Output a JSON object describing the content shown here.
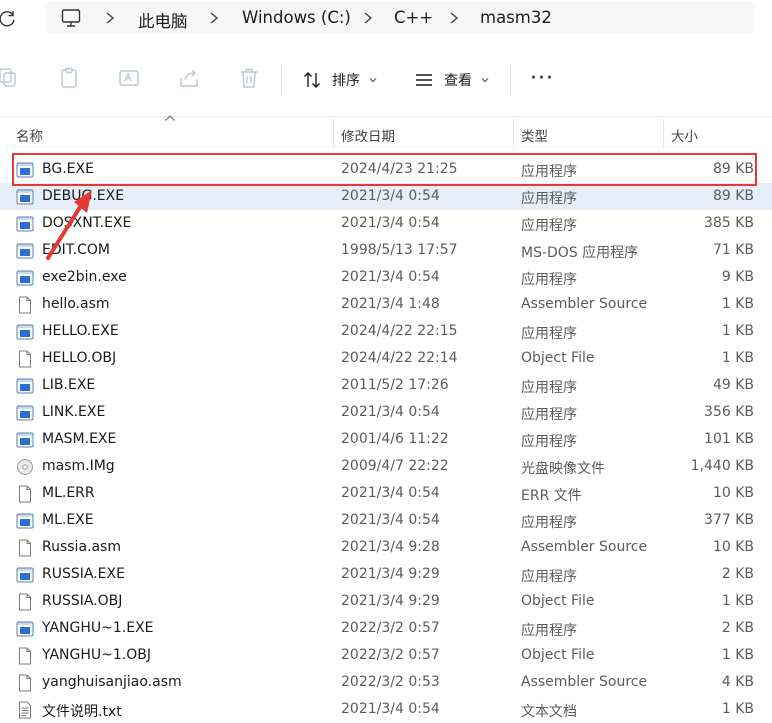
{
  "address": {
    "crumbs": [
      "此电脑",
      "Windows (C:)",
      "C++",
      "masm32"
    ]
  },
  "toolbar": {
    "sort_label": "排序",
    "view_label": "查看",
    "more_label": "···"
  },
  "columns": {
    "name": "名称",
    "date": "修改日期",
    "type": "类型",
    "size": "大小"
  },
  "files": [
    {
      "name": "BG.EXE",
      "date": "2024/4/23 21:25",
      "type": "应用程序",
      "size": "89 KB",
      "icon": "exe-icon"
    },
    {
      "name": "DEBUG.EXE",
      "date": "2021/3/4 0:54",
      "type": "应用程序",
      "size": "89 KB",
      "icon": "exe-icon"
    },
    {
      "name": "DOSXNT.EXE",
      "date": "2021/3/4 0:54",
      "type": "应用程序",
      "size": "385 KB",
      "icon": "exe-icon"
    },
    {
      "name": "EDIT.COM",
      "date": "1998/5/13 17:57",
      "type": "MS-DOS 应用程序",
      "size": "71 KB",
      "icon": "exe-icon"
    },
    {
      "name": "exe2bin.exe",
      "date": "2021/3/4 0:54",
      "type": "应用程序",
      "size": "9 KB",
      "icon": "exe-icon"
    },
    {
      "name": "hello.asm",
      "date": "2021/3/4 1:48",
      "type": "Assembler Source",
      "size": "1 KB",
      "icon": "file-icon"
    },
    {
      "name": "HELLO.EXE",
      "date": "2024/4/22 22:15",
      "type": "应用程序",
      "size": "1 KB",
      "icon": "exe-icon"
    },
    {
      "name": "HELLO.OBJ",
      "date": "2024/4/22 22:14",
      "type": "Object File",
      "size": "1 KB",
      "icon": "file-icon"
    },
    {
      "name": "LIB.EXE",
      "date": "2011/5/2 17:26",
      "type": "应用程序",
      "size": "49 KB",
      "icon": "exe-icon"
    },
    {
      "name": "LINK.EXE",
      "date": "2021/3/4 0:54",
      "type": "应用程序",
      "size": "356 KB",
      "icon": "exe-icon"
    },
    {
      "name": "MASM.EXE",
      "date": "2001/4/6 11:22",
      "type": "应用程序",
      "size": "101 KB",
      "icon": "exe-icon"
    },
    {
      "name": "masm.IMg",
      "date": "2009/4/7 22:22",
      "type": "光盘映像文件",
      "size": "1,440 KB",
      "icon": "disc-icon"
    },
    {
      "name": "ML.ERR",
      "date": "2021/3/4 0:54",
      "type": "ERR 文件",
      "size": "10 KB",
      "icon": "file-icon"
    },
    {
      "name": "ML.EXE",
      "date": "2021/3/4 0:54",
      "type": "应用程序",
      "size": "377 KB",
      "icon": "exe-icon"
    },
    {
      "name": "Russia.asm",
      "date": "2021/3/4 9:28",
      "type": "Assembler Source",
      "size": "10 KB",
      "icon": "file-icon"
    },
    {
      "name": "RUSSIA.EXE",
      "date": "2021/3/4 9:29",
      "type": "应用程序",
      "size": "2 KB",
      "icon": "exe-icon"
    },
    {
      "name": "RUSSIA.OBJ",
      "date": "2021/3/4 9:29",
      "type": "Object File",
      "size": "1 KB",
      "icon": "file-icon"
    },
    {
      "name": "YANGHU~1.EXE",
      "date": "2022/3/2 0:57",
      "type": "应用程序",
      "size": "2 KB",
      "icon": "exe-icon"
    },
    {
      "name": "YANGHU~1.OBJ",
      "date": "2022/3/2 0:57",
      "type": "Object File",
      "size": "1 KB",
      "icon": "file-icon"
    },
    {
      "name": "yanghuisanjiao.asm",
      "date": "2022/3/2 0:53",
      "type": "Assembler Source",
      "size": "4 KB",
      "icon": "file-icon"
    },
    {
      "name": "文件说明.txt",
      "date": "2021/3/4 0:54",
      "type": "文本文档",
      "size": "1 KB",
      "icon": "text-file-icon"
    }
  ],
  "selected_index": 1,
  "highlighted_index": 0,
  "colors": {
    "highlight_box": "#e53935",
    "selection": "#e6eff9",
    "exe_icon_blue": "#2b6fd6"
  }
}
